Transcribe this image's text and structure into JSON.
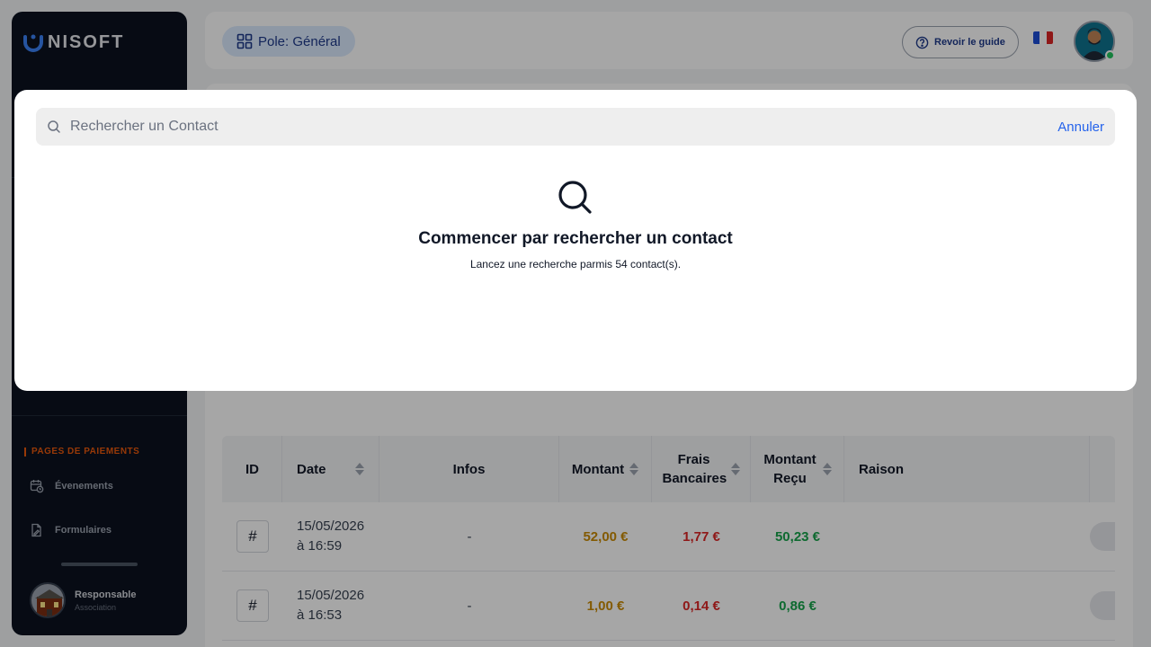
{
  "app": {
    "logo_text": "NISOFT"
  },
  "topbar": {
    "pole_label": "Pole: Général",
    "guide_label": "Revoir le guide"
  },
  "sidebar": {
    "section_title": "PAGES DE PAIEMENTS",
    "items": [
      {
        "label": "Évenements",
        "icon": "calendar-clock-icon"
      },
      {
        "label": "Formulaires",
        "icon": "form-icon"
      }
    ],
    "profile": {
      "name": "Responsable",
      "role": "Association"
    }
  },
  "table": {
    "headers": {
      "id": "ID",
      "date": "Date",
      "infos": "Infos",
      "montant": "Montant",
      "frais": "Frais Bancaires",
      "recu": "Montant Reçu",
      "raison": "Raison"
    },
    "rows": [
      {
        "id": "#",
        "date_line1": "15/05/2026",
        "date_line2": "à 16:59",
        "infos": "-",
        "montant": "52,00 €",
        "frais": "1,77 €",
        "recu": "50,23 €"
      },
      {
        "id": "#",
        "date_line1": "15/05/2026",
        "date_line2": "à 16:53",
        "infos": "-",
        "montant": "1,00 €",
        "frais": "0,14 €",
        "recu": "0,86 €"
      }
    ]
  },
  "colors": {
    "montant": "#ca8a04",
    "frais": "#dc2626",
    "recu": "#16a34a"
  },
  "modal": {
    "search_placeholder": "Rechercher un Contact",
    "cancel_label": "Annuler",
    "empty_title": "Commencer par rechercher un contact",
    "empty_subtitle": "Lancez une recherche parmis 54 contact(s)."
  }
}
